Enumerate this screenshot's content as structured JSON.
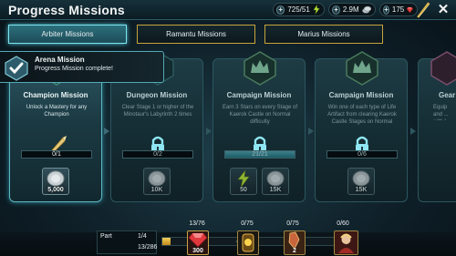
{
  "header": {
    "title": "Progress Missions",
    "energy": "725/51",
    "silver": "2.9M",
    "gems": "175",
    "close_symbol": "✕"
  },
  "tabs": [
    {
      "label": "Arbiter Missions",
      "active": true
    },
    {
      "label": "Ramantu Missions",
      "active": false
    },
    {
      "label": "Marius Missions",
      "active": false
    }
  ],
  "toast": {
    "title": "Arena Mission",
    "subtitle": "Progress Mission complete!"
  },
  "cards": [
    {
      "title": "Champion Mission",
      "description": "Unlock a Mastery for any Champion",
      "progress_text": "0/1",
      "progress_fraction": 0,
      "status_icon": "quill-icon",
      "rewards": [
        {
          "icon": "silver-coin-icon",
          "label": "5,000"
        }
      ]
    },
    {
      "title": "Dungeon Mission",
      "description": "Clear Stage 1 or higher of the Minotaur's Labyrinth 2 times",
      "progress_text": "0/2",
      "progress_fraction": 0,
      "status_icon": "lock-icon",
      "rewards": [
        {
          "icon": "silver-coin-icon",
          "label": "10K"
        }
      ]
    },
    {
      "title": "Campaign Mission",
      "description": "Earn 3 Stars on every Stage of Kaerok Castle on Normal difficulty",
      "progress_text": "21/21",
      "progress_fraction": 1,
      "status_icon": "lock-icon",
      "rewards": [
        {
          "icon": "energy-icon",
          "label": "50"
        },
        {
          "icon": "silver-coin-icon",
          "label": "15K"
        }
      ]
    },
    {
      "title": "Campaign Mission",
      "description": "Win one of each type of Life Artifact from clearing Kaerok Castle Stages on Normal",
      "progress_text": "0/6",
      "progress_fraction": 0,
      "status_icon": "lock-icon",
      "rewards": [
        {
          "icon": "silver-coin-icon",
          "label": "15K"
        }
      ]
    },
    {
      "title": "Gear",
      "description": "Equip and ... with L...",
      "progress_text": "",
      "progress_fraction": 0,
      "status_icon": "",
      "rewards": []
    }
  ],
  "bottom": {
    "part_label": "Part",
    "part_value": "1/4",
    "total_progress": "13/286",
    "track_fraction": 0.04,
    "milestones": [
      {
        "count": "13/76",
        "reward": "300",
        "icon": "gem-icon"
      },
      {
        "count": "0/75",
        "reward": "",
        "icon": "relic-icon"
      },
      {
        "count": "0/75",
        "reward": "2",
        "icon": "shard-icon"
      },
      {
        "count": "0/60",
        "reward": "",
        "icon": "champion-portrait-icon"
      }
    ]
  },
  "colors": {
    "accent": "#5fd2e0",
    "gold": "#c8a33d"
  }
}
